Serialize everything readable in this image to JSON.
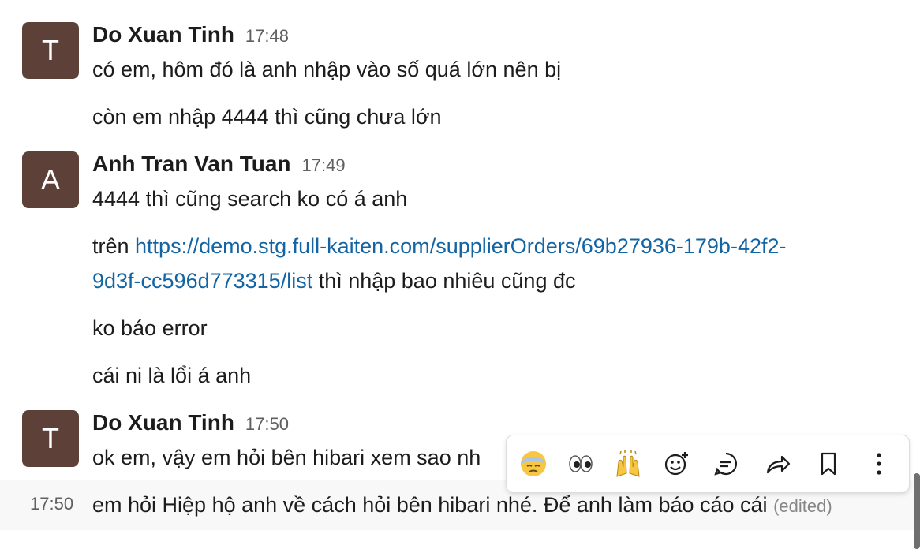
{
  "messages": [
    {
      "avatar_letter": "T",
      "author": "Do Xuan Tinh",
      "time": "17:48",
      "lines": [
        "có em, hôm đó là anh nhập vào số quá lớn nên bị",
        "còn em nhập 4444 thì cũng chưa lớn"
      ]
    },
    {
      "avatar_letter": "A",
      "author": "Anh Tran Van Tuan",
      "time": "17:49",
      "line1": "4444 thì cũng search ko có á anh",
      "link_prefix": "trên ",
      "link_part1": "https://demo.stg.full-kaiten.com/supplierOrders/69b27936-179b-42f2-",
      "link_part2": "9d3f-cc596d773315/list",
      "link_suffix": " thì nhập bao nhiêu cũng đc",
      "line4": "ko báo error",
      "line5": "cái ni là lổi á anh"
    },
    {
      "avatar_letter": "T",
      "author": "Do Xuan Tinh",
      "time": "17:50",
      "line1": "ok em, vậy em hỏi bên hibari xem sao nh",
      "continuation_time": "17:50",
      "continuation_text": "em hỏi Hiệp hộ anh về cách hỏi bên hibari nhé. Để anh làm báo cáo cái ",
      "edited_label": "(edited)"
    }
  ],
  "toolbar": {
    "buttons": [
      "downcast-face-emoji",
      "eyes-emoji",
      "raised-hands-emoji",
      "add-reaction-icon",
      "reply-in-thread-icon",
      "share-forward-icon",
      "save-bookmark-icon",
      "more-actions-icon"
    ]
  },
  "colors": {
    "avatar_bg": "#5d4037",
    "link": "#1264a3"
  }
}
